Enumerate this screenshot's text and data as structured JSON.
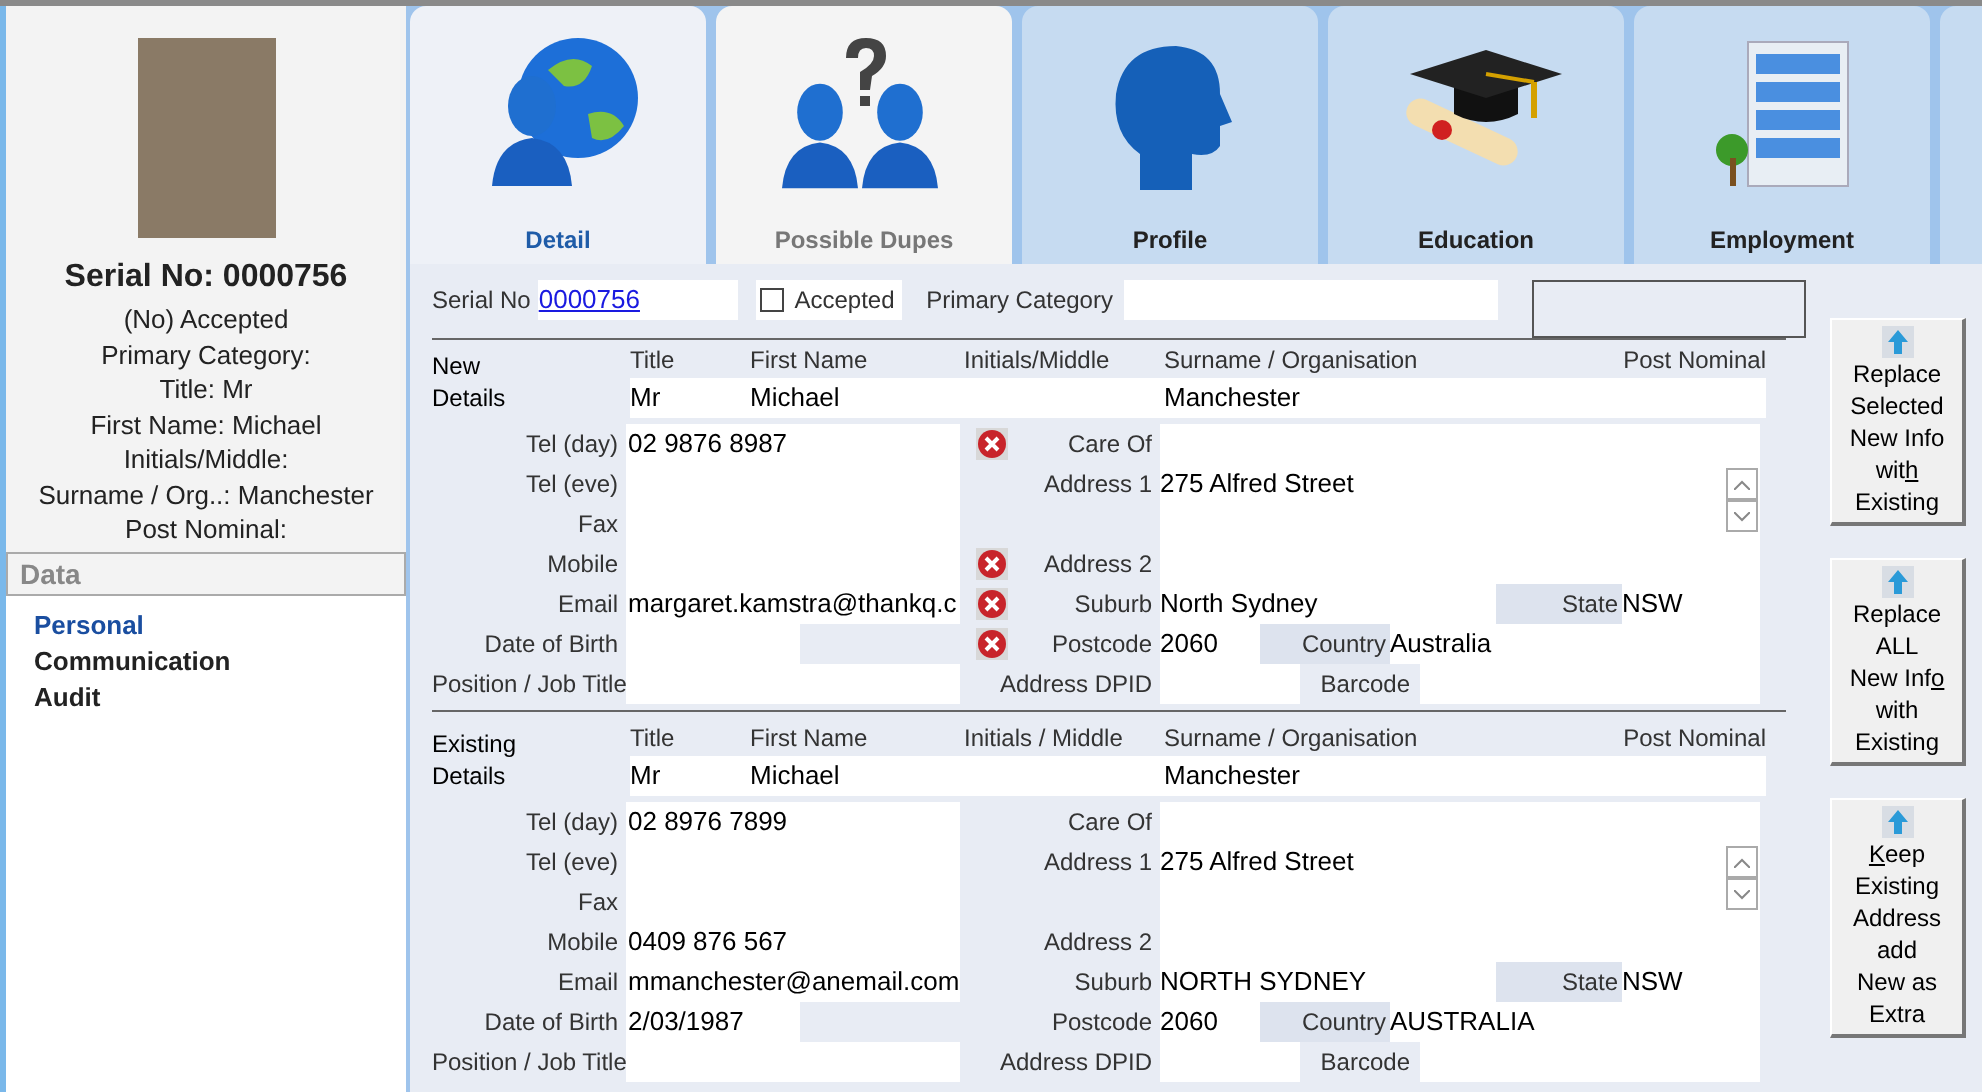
{
  "sidebar": {
    "serial": "Serial No: 0000756",
    "summary": [
      "(No) Accepted",
      "Primary Category:",
      "Title: Mr",
      "First Name: Michael",
      "Initials/Middle:",
      "Surname / Org..: Manchester",
      "Post Nominal:"
    ],
    "data_header": "Data",
    "nav": [
      {
        "label": "Personal",
        "selected": true
      },
      {
        "label": "Communication",
        "selected": false
      },
      {
        "label": "Audit",
        "selected": false
      }
    ]
  },
  "tabs": [
    {
      "label": "Detail",
      "kind": "globe",
      "selected": true,
      "dimmed": false
    },
    {
      "label": "Possible Dupes",
      "kind": "dupes",
      "selected": false,
      "dimmed": true
    },
    {
      "label": "Profile",
      "kind": "head",
      "selected": false,
      "dimmed": false
    },
    {
      "label": "Education",
      "kind": "cap",
      "selected": false,
      "dimmed": false
    },
    {
      "label": "Employment",
      "kind": "building",
      "selected": false,
      "dimmed": false
    }
  ],
  "record": {
    "serial_label": "Serial No",
    "serial_value": "0000756",
    "accepted_label": "Accepted",
    "accepted_checked": false,
    "primary_category_label": "Primary Category"
  },
  "sections": [
    {
      "heading": "New Details",
      "name_headers": [
        "Title",
        "First Name",
        "Initials/Middle",
        "Surname / Organisation",
        "Post Nominal"
      ],
      "title": "Mr",
      "first_name": "Michael",
      "surname": "Manchester",
      "contact": [
        {
          "label": "Tel (day)",
          "value": "02 9876 8987",
          "flagged": true,
          "kind": "text"
        },
        {
          "label": "Tel (eve)",
          "flagged": false,
          "kind": "text"
        },
        {
          "label": "Fax",
          "flagged": false,
          "kind": "text"
        },
        {
          "label": "Mobile",
          "flagged": true,
          "kind": "text"
        },
        {
          "label": "Email",
          "value": "margaret.kamstra@thankq.c",
          "flagged": true,
          "kind": "text"
        },
        {
          "label": "Date of Birth",
          "flagged": true,
          "kind": "date"
        },
        {
          "label": "Position / Job Title",
          "flagged": false,
          "kind": "text"
        }
      ],
      "address": {
        "care_of_label": "Care Of",
        "address1_label": "Address 1",
        "address1": "275 Alfred Street",
        "address2_label": "Address 2",
        "suburb_label": "Suburb",
        "suburb": "North Sydney",
        "state_label": "State",
        "state": "NSW",
        "postcode_label": "Postcode",
        "postcode": "2060",
        "country_label": "Country",
        "country": "Australia",
        "dpid_label": "Address DPID",
        "barcode_label": "Barcode"
      }
    },
    {
      "heading": "Existing Details",
      "name_headers": [
        "Title",
        "First Name",
        "Initials / Middle",
        "Surname / Organisation",
        "Post Nominal"
      ],
      "title": "Mr",
      "first_name": "Michael",
      "surname": "Manchester",
      "contact": [
        {
          "label": "Tel (day)",
          "value": "02 8976 7899",
          "flagged": false,
          "kind": "text"
        },
        {
          "label": "Tel (eve)",
          "flagged": false,
          "kind": "text"
        },
        {
          "label": "Fax",
          "flagged": false,
          "kind": "text"
        },
        {
          "label": "Mobile",
          "value": "0409 876 567",
          "flagged": false,
          "kind": "text"
        },
        {
          "label": "Email",
          "value": "mmanchester@anemail.com",
          "flagged": false,
          "kind": "text"
        },
        {
          "label": "Date of Birth",
          "value": "2/03/1987",
          "flagged": false,
          "kind": "date"
        },
        {
          "label": "Position / Job Title",
          "flagged": false,
          "kind": "text"
        }
      ],
      "address": {
        "care_of_label": "Care Of",
        "address1_label": "Address 1",
        "address1": "275 Alfred Street",
        "address2_label": "Address 2",
        "suburb_label": "Suburb",
        "suburb": "NORTH SYDNEY",
        "state_label": "State",
        "state": "NSW",
        "postcode_label": "Postcode",
        "postcode": "2060",
        "country_label": "Country",
        "country": "AUSTRALIA",
        "dpid_label": "Address DPID",
        "barcode_label": "Barcode"
      }
    }
  ],
  "actions": [
    {
      "lines": [
        [
          {
            "text": "Replace",
            "underline": false
          }
        ],
        [
          {
            "text": "Selected",
            "underline": false
          }
        ],
        [
          {
            "text": "New Info",
            "underline": false
          }
        ],
        [
          {
            "text": "wit",
            "underline": false
          },
          {
            "text": "h",
            "underline": true
          }
        ],
        [
          {
            "text": "Existing",
            "underline": false
          }
        ]
      ]
    },
    {
      "lines": [
        [
          {
            "text": "Replace",
            "underline": false
          }
        ],
        [
          {
            "text": "ALL",
            "underline": false
          }
        ],
        [
          {
            "text": "New Inf",
            "underline": false
          },
          {
            "text": "o",
            "underline": true
          }
        ],
        [
          {
            "text": "with",
            "underline": false
          }
        ],
        [
          {
            "text": "Existing",
            "underline": false
          }
        ]
      ]
    },
    {
      "lines": [
        [
          {
            "text": "K",
            "underline": true
          },
          {
            "text": "eep",
            "underline": false
          }
        ],
        [
          {
            "text": "Existing",
            "underline": false
          }
        ],
        [
          {
            "text": "Address",
            "underline": false
          }
        ],
        [
          {
            "text": "add",
            "underline": false
          }
        ],
        [
          {
            "text": "New as",
            "underline": false
          }
        ],
        [
          {
            "text": "Extra",
            "underline": false
          }
        ]
      ]
    }
  ]
}
